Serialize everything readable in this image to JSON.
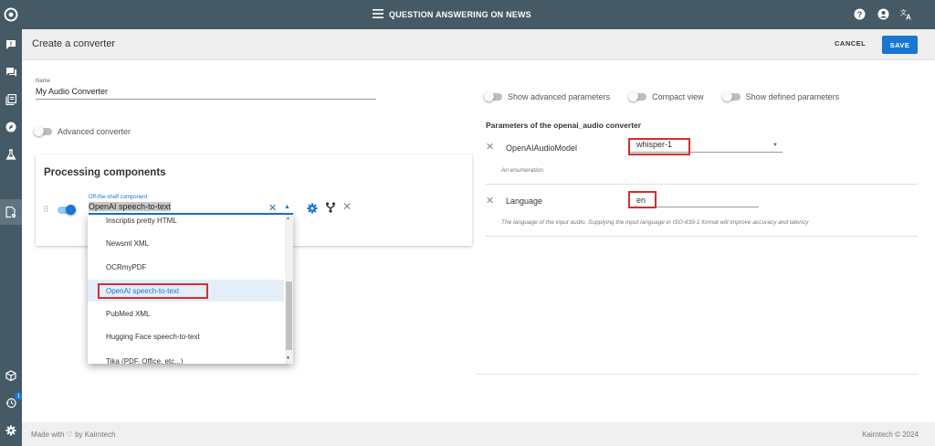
{
  "app": {
    "title": "QUESTION ANSWERING ON NEWS",
    "icons": [
      "menu-icon",
      "help-icon",
      "account-icon",
      "translate-icon"
    ]
  },
  "sidebar": {
    "icons": [
      "feedback-icon",
      "forum-icon",
      "library-icon",
      "explore-icon",
      "lab-icon",
      "document-gear-icon",
      "cube-icon",
      "history-icon",
      "settings-icon"
    ],
    "badge": "1"
  },
  "header": {
    "title": "Create a converter",
    "cancel_label": "CANCEL",
    "save_label": "SAVE"
  },
  "form": {
    "name_label": "Name",
    "name_value": "My Audio Converter",
    "advanced_converter_label": "Advanced converter"
  },
  "processing": {
    "title": "Processing components",
    "component_label": "Off-the-shelf component",
    "component_value": "OpenAI speech-to-text"
  },
  "dropdown": {
    "options": [
      "Inscriptis pretty HTML",
      "Newsml XML",
      "OCRmyPDF",
      "OpenAI speech-to-text",
      "PubMed XML",
      "Hugging Face speech-to-text",
      "Tika (PDF, Office, etc...)"
    ],
    "selected": "OpenAI speech-to-text"
  },
  "options_bar": {
    "show_advanced": "Show advanced parameters",
    "compact_view": "Compact view",
    "show_defined": "Show defined parameters"
  },
  "parameters": {
    "title": "Parameters of the openai_audio converter",
    "model": {
      "name": "OpenAIAudioModel",
      "value": "whisper-1",
      "description": "An enumeration."
    },
    "language": {
      "name": "Language",
      "value": "en",
      "description": "The language of the input audio. Supplying the input language in ISO-639-1 format will improve accuracy and latency"
    }
  },
  "footer": {
    "left": "Made with ♡ by Kairntech",
    "right": "Kairntech © 2024"
  },
  "colors": {
    "topbar": "#455a64",
    "accent": "#1976d2",
    "highlight_box": "#d32f2f"
  }
}
